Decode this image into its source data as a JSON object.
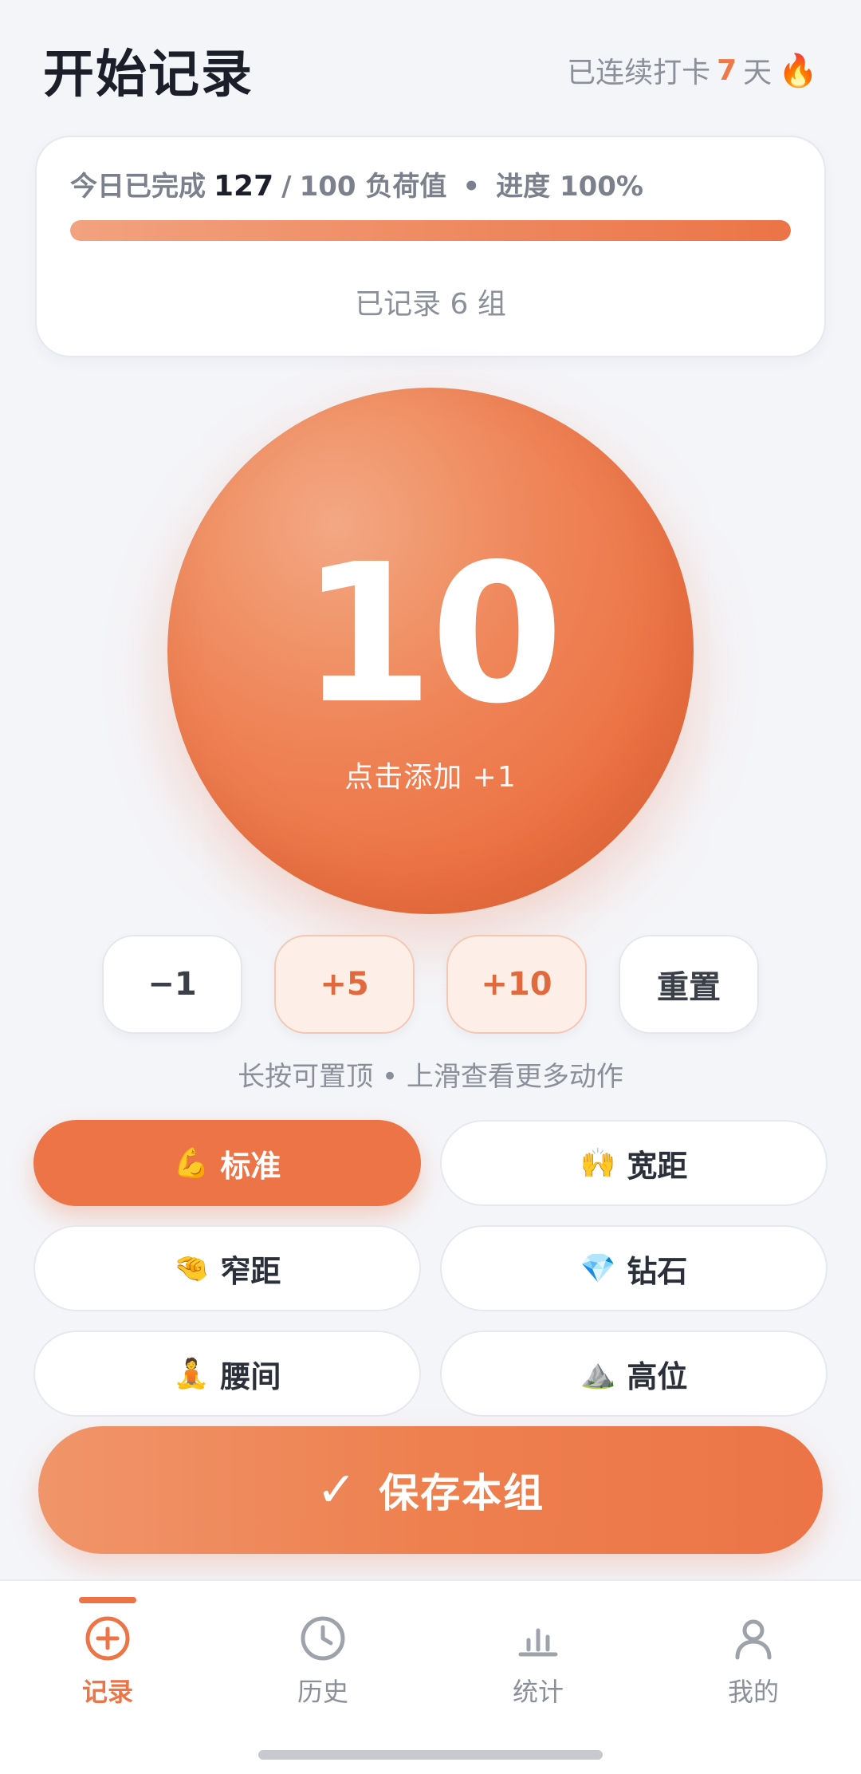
{
  "header": {
    "title": "开始记录",
    "streak_prefix": "已连续打卡",
    "streak_days": "7",
    "streak_suffix": "天",
    "streak_icon": "🔥"
  },
  "progress": {
    "prefix": "今日已完成",
    "completed": "127",
    "separator": "/",
    "target_text": "100 负荷值",
    "dot": "•",
    "progress_text": "进度 100%",
    "progress_fraction": 1.0,
    "groups_text": "已记录 6 组"
  },
  "counter": {
    "value": "10",
    "tap_label": "点击添加 +1"
  },
  "quick_buttons": [
    {
      "label": "−1"
    },
    {
      "label": "+5"
    },
    {
      "label": "+10"
    },
    {
      "label": "重置"
    }
  ],
  "hint": "长按可置顶 • 上滑查看更多动作",
  "grips": [
    {
      "emoji": "💪",
      "label": "标准",
      "selected": true
    },
    {
      "emoji": "🙌",
      "label": "宽距",
      "selected": false
    },
    {
      "emoji": "🤏",
      "label": "窄距",
      "selected": false
    },
    {
      "emoji": "💎",
      "label": "钻石",
      "selected": false
    },
    {
      "emoji": "🧘",
      "label": "腰间",
      "selected": false
    },
    {
      "emoji": "⛰️",
      "label": "高位",
      "selected": false
    }
  ],
  "save_button": {
    "check": "✓",
    "label": "保存本组"
  },
  "tabs": [
    {
      "label": "记录",
      "icon": "plus-circle-icon",
      "active": true
    },
    {
      "label": "历史",
      "icon": "clock-icon",
      "active": false
    },
    {
      "label": "统计",
      "icon": "bar-chart-icon",
      "active": false
    },
    {
      "label": "我的",
      "icon": "user-icon",
      "active": false
    }
  ],
  "colors": {
    "accent": "#ec7447",
    "accent_light": "#fdefe8",
    "text_primary": "#1c1f2a",
    "text_secondary": "#8a8f99",
    "background": "#f4f5f9"
  }
}
